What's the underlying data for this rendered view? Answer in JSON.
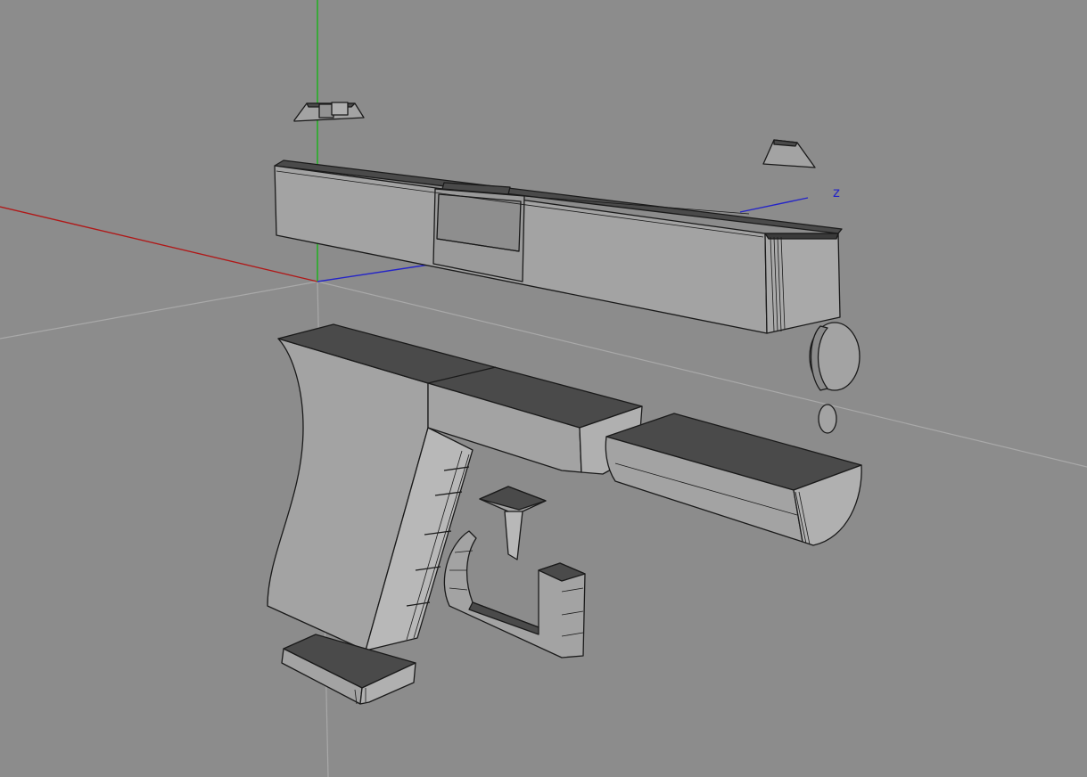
{
  "viewport": {
    "axis_z_label": "z",
    "background_color": "#8c8c8c",
    "colors": {
      "x_axis": "#b01818",
      "y_axis": "#17b317",
      "z_axis": "#2424c8",
      "grid_line": "#a9a9a9",
      "mesh_light": "#a3a3a3",
      "mesh_mid": "#939393",
      "mesh_dark": "#4a4a4a",
      "edge": "#1a1a1a"
    }
  },
  "objects": [
    {
      "name": "rear-sight",
      "kind": "mesh"
    },
    {
      "name": "front-sight",
      "kind": "mesh"
    },
    {
      "name": "slide",
      "kind": "mesh"
    },
    {
      "name": "barrel-cap",
      "kind": "mesh"
    },
    {
      "name": "barrel-pin",
      "kind": "mesh"
    },
    {
      "name": "frame",
      "kind": "mesh"
    },
    {
      "name": "barrel",
      "kind": "mesh"
    },
    {
      "name": "trigger",
      "kind": "mesh"
    },
    {
      "name": "trigger-guard",
      "kind": "mesh"
    },
    {
      "name": "magazine-baseplate",
      "kind": "mesh"
    }
  ]
}
